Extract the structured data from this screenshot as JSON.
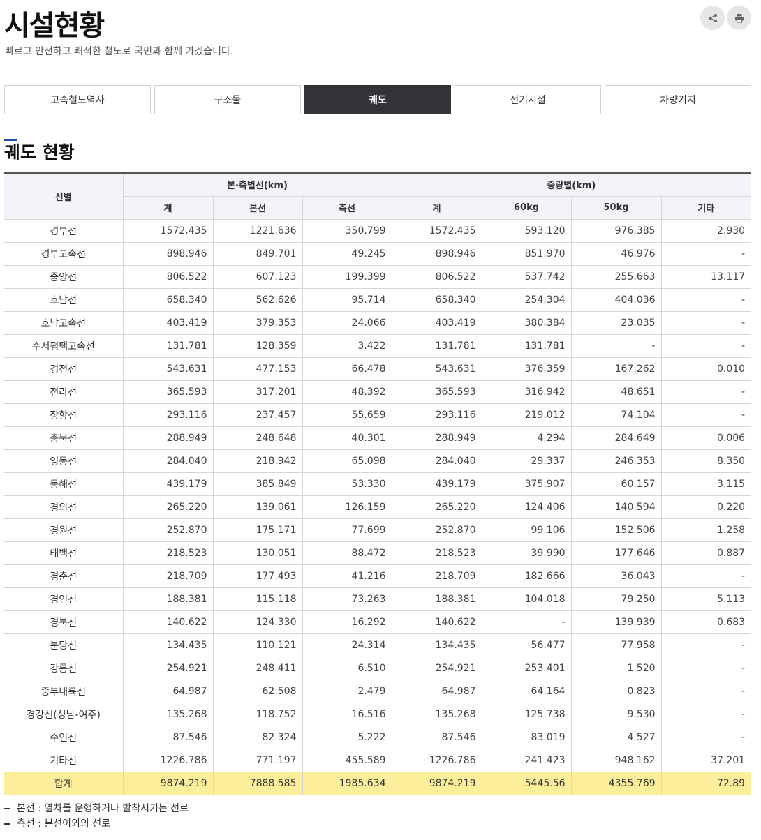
{
  "header": {
    "title": "시설현황",
    "subtitle": "빠르고 안전하고 쾌적한 철도로 국민과 함께 가겠습니다."
  },
  "utility": {
    "share_icon": "share-icon",
    "print_icon": "print-icon"
  },
  "tabs": [
    {
      "label": "고속철도역사",
      "active": false
    },
    {
      "label": "구조물",
      "active": false
    },
    {
      "label": "궤도",
      "active": true
    },
    {
      "label": "전기시설",
      "active": false
    },
    {
      "label": "차량기지",
      "active": false
    }
  ],
  "section": {
    "title": "궤도 현황"
  },
  "table": {
    "headers": {
      "line": "선별",
      "group_main_side": "본·측별선(km)",
      "group_weight": "중량별(km)",
      "total1": "계",
      "main": "본선",
      "side": "측선",
      "total2": "계",
      "kg60": "60kg",
      "kg50": "50kg",
      "other": "기타"
    },
    "rows": [
      [
        "경부선",
        "1572.435",
        "1221.636",
        "350.799",
        "1572.435",
        "593.120",
        "976.385",
        "2.930"
      ],
      [
        "경부고속선",
        "898.946",
        "849.701",
        "49.245",
        "898.946",
        "851.970",
        "46.976",
        "-"
      ],
      [
        "중앙선",
        "806.522",
        "607.123",
        "199.399",
        "806.522",
        "537.742",
        "255.663",
        "13.117"
      ],
      [
        "호남선",
        "658.340",
        "562.626",
        "95.714",
        "658.340",
        "254.304",
        "404.036",
        "-"
      ],
      [
        "호남고속선",
        "403.419",
        "379.353",
        "24.066",
        "403.419",
        "380.384",
        "23.035",
        "-"
      ],
      [
        "수서평택고속선",
        "131.781",
        "128.359",
        "3.422",
        "131.781",
        "131.781",
        "-",
        "-"
      ],
      [
        "경전선",
        "543.631",
        "477.153",
        "66.478",
        "543.631",
        "376.359",
        "167.262",
        "0.010"
      ],
      [
        "전라선",
        "365.593",
        "317.201",
        "48.392",
        "365.593",
        "316.942",
        "48.651",
        "-"
      ],
      [
        "장항선",
        "293.116",
        "237.457",
        "55.659",
        "293.116",
        "219.012",
        "74.104",
        "-"
      ],
      [
        "충북선",
        "288.949",
        "248.648",
        "40.301",
        "288.949",
        "4.294",
        "284.649",
        "0.006"
      ],
      [
        "영동선",
        "284.040",
        "218.942",
        "65.098",
        "284.040",
        "29.337",
        "246.353",
        "8.350"
      ],
      [
        "동해선",
        "439.179",
        "385.849",
        "53.330",
        "439.179",
        "375.907",
        "60.157",
        "3.115"
      ],
      [
        "경의선",
        "265.220",
        "139.061",
        "126.159",
        "265.220",
        "124.406",
        "140.594",
        "0.220"
      ],
      [
        "경원선",
        "252.870",
        "175.171",
        "77.699",
        "252.870",
        "99.106",
        "152.506",
        "1.258"
      ],
      [
        "태백선",
        "218.523",
        "130.051",
        "88.472",
        "218.523",
        "39.990",
        "177.646",
        "0.887"
      ],
      [
        "경춘선",
        "218.709",
        "177.493",
        "41.216",
        "218.709",
        "182.666",
        "36.043",
        "-"
      ],
      [
        "경인선",
        "188.381",
        "115.118",
        "73.263",
        "188.381",
        "104.018",
        "79.250",
        "5.113"
      ],
      [
        "경북선",
        "140.622",
        "124.330",
        "16.292",
        "140.622",
        "-",
        "139.939",
        "0.683"
      ],
      [
        "분당선",
        "134.435",
        "110.121",
        "24.314",
        "134.435",
        "56.477",
        "77.958",
        "-"
      ],
      [
        "강릉선",
        "254.921",
        "248.411",
        "6.510",
        "254.921",
        "253.401",
        "1.520",
        "-"
      ],
      [
        "중부내륙선",
        "64.987",
        "62.508",
        "2.479",
        "64.987",
        "64.164",
        "0.823",
        "-"
      ],
      [
        "경강선(성남-여주)",
        "135.268",
        "118.752",
        "16.516",
        "135.268",
        "125.738",
        "9.530",
        "-"
      ],
      [
        "수인선",
        "87.546",
        "82.324",
        "5.222",
        "87.546",
        "83.019",
        "4.527",
        "-"
      ],
      [
        "기타선",
        "1226.786",
        "771.197",
        "455.589",
        "1226.786",
        "241.423",
        "948.162",
        "37.201"
      ]
    ],
    "total": [
      "합계",
      "9874.219",
      "7888.585",
      "1985.634",
      "9874.219",
      "5445.56",
      "4355.769",
      "72.89"
    ]
  },
  "notes": [
    "본선 : 열차를 운행하거나 발착시키는 선로",
    "측선 : 본선이외의 선로"
  ]
}
